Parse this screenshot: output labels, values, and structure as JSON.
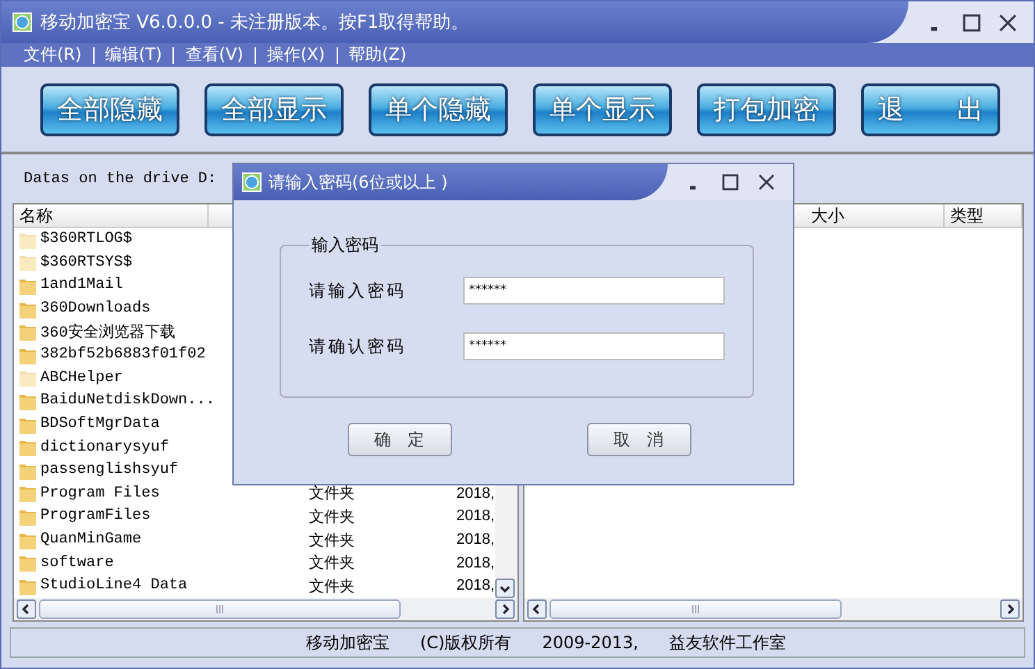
{
  "window": {
    "title": "移动加密宝 V6.0.0.0 - 未注册版本。按F1取得帮助。"
  },
  "menu": [
    "文件(R)",
    "编辑(T)",
    "查看(V)",
    "操作(X)",
    "帮助(Z)"
  ],
  "toolbar": [
    "全部隐藏",
    "全部显示",
    "单个隐藏",
    "单个显示",
    "打包加密",
    "退　　出"
  ],
  "drive_label": "Datas on the drive D:",
  "left_list": {
    "columns": [
      "名称"
    ],
    "rows": [
      {
        "name": "$360RTLOG$",
        "hidden": true
      },
      {
        "name": "$360RTSYS$",
        "hidden": true
      },
      {
        "name": "1and1Mail",
        "hidden": false
      },
      {
        "name": "360Downloads",
        "hidden": false
      },
      {
        "name": "360安全浏览器下载",
        "hidden": false
      },
      {
        "name": "382bf52b6883f01f02",
        "hidden": false
      },
      {
        "name": "ABCHelper",
        "hidden": true
      },
      {
        "name": "BaiduNetdiskDown...",
        "hidden": false
      },
      {
        "name": "BDSoftMgrData",
        "hidden": false
      },
      {
        "name": "dictionarysyuf",
        "hidden": false
      },
      {
        "name": "passenglishsyuf",
        "hidden": false
      },
      {
        "name": "Program Files",
        "hidden": false,
        "type": "文件夹",
        "date": "2018,"
      },
      {
        "name": "ProgramFiles",
        "hidden": false,
        "type": "文件夹",
        "date": "2018,"
      },
      {
        "name": "QuanMinGame",
        "hidden": false,
        "type": "文件夹",
        "date": "2018,"
      },
      {
        "name": "software",
        "hidden": false,
        "type": "文件夹",
        "date": "2018,"
      },
      {
        "name": "StudioLine4 Data",
        "hidden": false,
        "type": "文件夹",
        "date": "2018,"
      }
    ]
  },
  "right_list": {
    "columns": [
      "大小",
      "类型"
    ]
  },
  "status_bar": [
    "移动加密宝",
    "(C)版权所有",
    "2009-2013,",
    "益友软件工作室"
  ],
  "dialog": {
    "title": "请输入密码(6位或以上 )",
    "group": "输入密码",
    "fields": [
      {
        "label": "请输入密码",
        "value": "******"
      },
      {
        "label": "请确认密码",
        "value": "******"
      }
    ],
    "buttons": [
      "确　定",
      "取　消"
    ]
  }
}
